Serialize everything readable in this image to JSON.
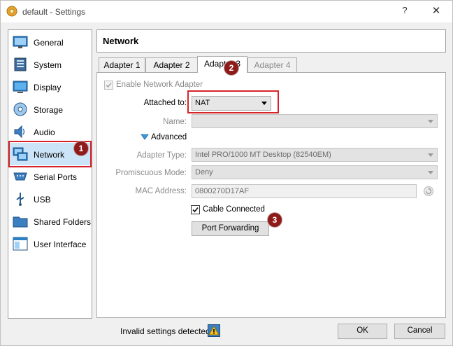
{
  "window": {
    "title": "default - Settings",
    "help_glyph": "?",
    "close_glyph": "✕"
  },
  "sidebar": {
    "items": [
      {
        "label": "General",
        "icon": "general-icon"
      },
      {
        "label": "System",
        "icon": "system-icon"
      },
      {
        "label": "Display",
        "icon": "display-icon"
      },
      {
        "label": "Storage",
        "icon": "storage-icon"
      },
      {
        "label": "Audio",
        "icon": "audio-icon"
      },
      {
        "label": "Network",
        "icon": "network-icon",
        "selected": true
      },
      {
        "label": "Serial Ports",
        "icon": "serial-ports-icon"
      },
      {
        "label": "USB",
        "icon": "usb-icon"
      },
      {
        "label": "Shared Folders",
        "icon": "shared-folders-icon"
      },
      {
        "label": "User Interface",
        "icon": "user-interface-icon"
      }
    ]
  },
  "header": {
    "title": "Network"
  },
  "tabs": [
    {
      "label": "Adapter 1"
    },
    {
      "label": "Adapter 2"
    },
    {
      "label": "Adapter 3",
      "active": true
    },
    {
      "label": "Adapter 4",
      "disabled": true
    }
  ],
  "adapter": {
    "enable_label": "Enable Network Adapter",
    "attached_label": "Attached to:",
    "attached_value": "NAT",
    "name_label": "Name:",
    "name_value": "",
    "advanced_label": "Advanced",
    "adapter_type_label": "Adapter Type:",
    "adapter_type_value": "Intel PRO/1000 MT Desktop (82540EM)",
    "promiscuous_label": "Promiscuous Mode:",
    "promiscuous_value": "Deny",
    "mac_label": "MAC Address:",
    "mac_value": "0800270D17AF",
    "cable_label": "Cable Connected",
    "port_forwarding_label": "Port Forwarding"
  },
  "annotations": [
    "1",
    "2",
    "3"
  ],
  "footer": {
    "status_text": "Invalid settings detected",
    "ok_label": "OK",
    "cancel_label": "Cancel"
  },
  "colors": {
    "highlight_red": "#d6232a",
    "badge_red": "#8e1a1a",
    "selection_blue": "#cce4f7"
  }
}
